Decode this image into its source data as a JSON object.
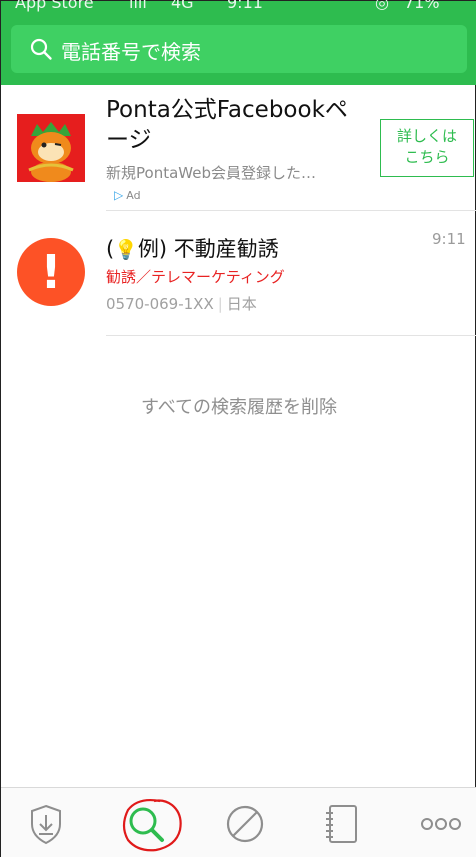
{
  "status_bar": {
    "carrier": "App Store",
    "network": "4G",
    "time": "9:11",
    "battery": "71%"
  },
  "search": {
    "placeholder": "電話番号で検索",
    "icon": "search-icon"
  },
  "ad": {
    "title": "Ponta公式Facebookページ",
    "description": "新規PontaWeb会員登録した…",
    "badge": "Ad",
    "button_label": "詳しくは こちら",
    "thumbnail": "ponta-mascot-image"
  },
  "history": [
    {
      "prefix": "(",
      "icon": "lightbulb-icon",
      "title": "例) 不動産勧誘",
      "time": "9:11",
      "category": "勧誘／テレマーケティング",
      "number": "0570-069-1XX",
      "country": "日本"
    }
  ],
  "delete_all_label": "すべての検索履歴を削除",
  "tabbar": {
    "tabs": [
      "shield-download-icon",
      "search-icon",
      "block-icon",
      "contacts-book-icon",
      "more-icon"
    ],
    "active": "search-icon",
    "accent": "#2ebc4f"
  },
  "colors": {
    "header_green": "#2ebc4f",
    "alert_orange": "#fd5226",
    "category_red": "#e82323"
  }
}
